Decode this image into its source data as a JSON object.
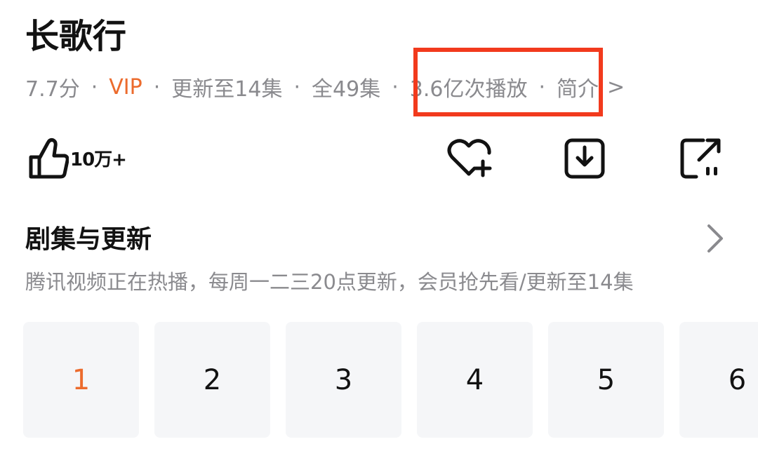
{
  "title": "长歌行",
  "meta": {
    "score": "7.7分",
    "separator": "·",
    "vip": "VIP",
    "update_status": "更新至14集",
    "total": "全49集",
    "plays": "3.6亿次播放",
    "intro": "简介",
    "intro_chevron": ">"
  },
  "colors": {
    "accent": "#ec6b2d",
    "highlight": "#f23a1d",
    "muted": "#8a8a8e",
    "tile_bg": "#f5f6f8"
  },
  "actions": {
    "like_count": "10万+",
    "icons": [
      "thumbs-up-icon",
      "heart-add-icon",
      "download-icon",
      "share-icon"
    ]
  },
  "section": {
    "title": "剧集与更新",
    "description": "腾讯视频正在热播，每周一二三20点更新，会员抢先看/更新至14集"
  },
  "episodes": [
    "1",
    "2",
    "3",
    "4",
    "5",
    "6"
  ],
  "active_episode": "1"
}
